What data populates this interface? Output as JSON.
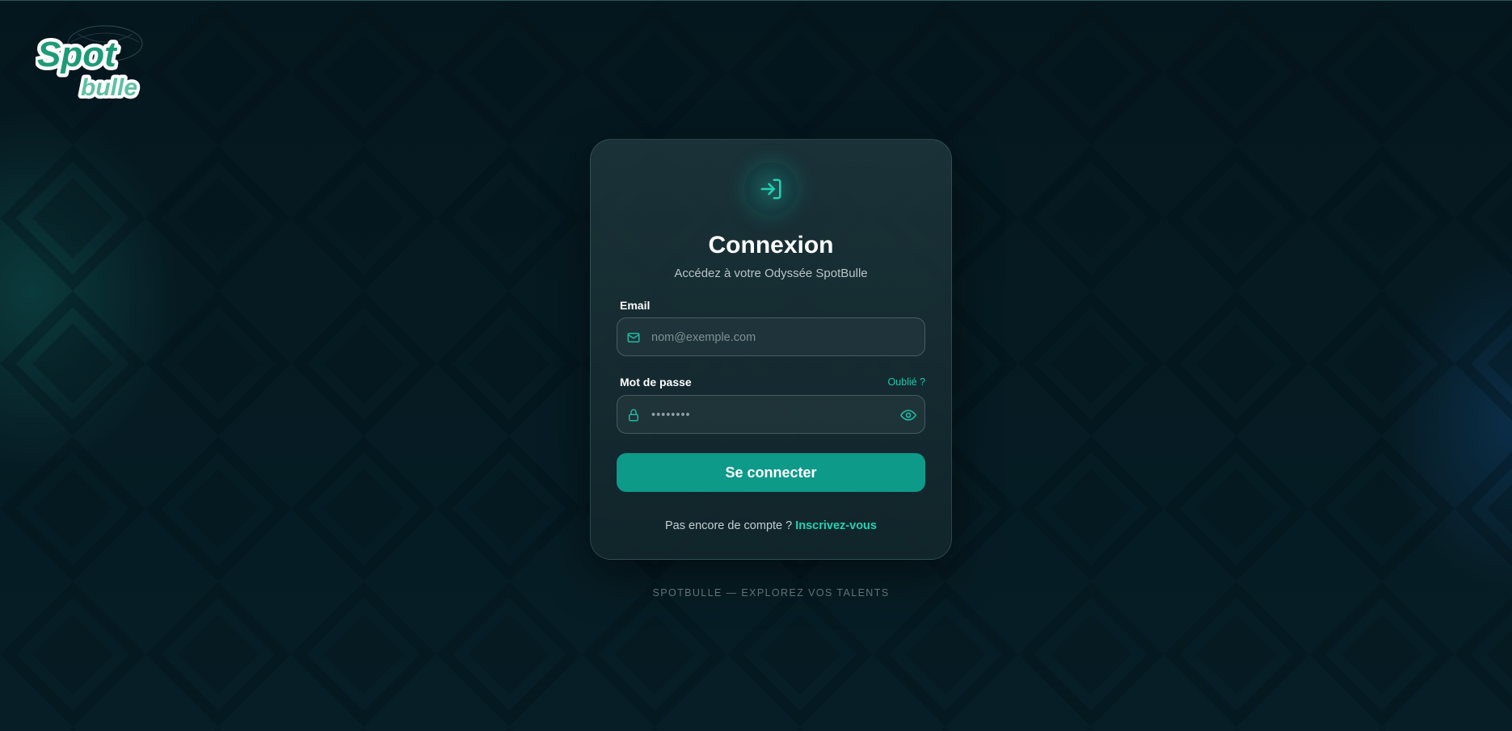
{
  "brand": {
    "logo_word_1": "Spot",
    "logo_word_2": "bulle",
    "accent_color": "#0e9a89",
    "link_color": "#22d1b3"
  },
  "login_card": {
    "icon": "login-arrow-icon",
    "title": "Connexion",
    "subtitle": "Accédez à votre Odyssée SpotBulle",
    "email": {
      "label": "Email",
      "placeholder": "nom@exemple.com",
      "value": "",
      "icon": "mail-icon"
    },
    "password": {
      "label": "Mot de passe",
      "forgot_link": "Oublié ?",
      "value": "••••••••",
      "icon": "lock-icon",
      "toggle_icon": "eye-icon"
    },
    "submit_label": "Se connecter",
    "signup_prompt": "Pas encore de compte ? ",
    "signup_link": "Inscrivez-vous"
  },
  "footer": {
    "tagline": "SPOTBULLE — EXPLOREZ VOS TALENTS"
  }
}
